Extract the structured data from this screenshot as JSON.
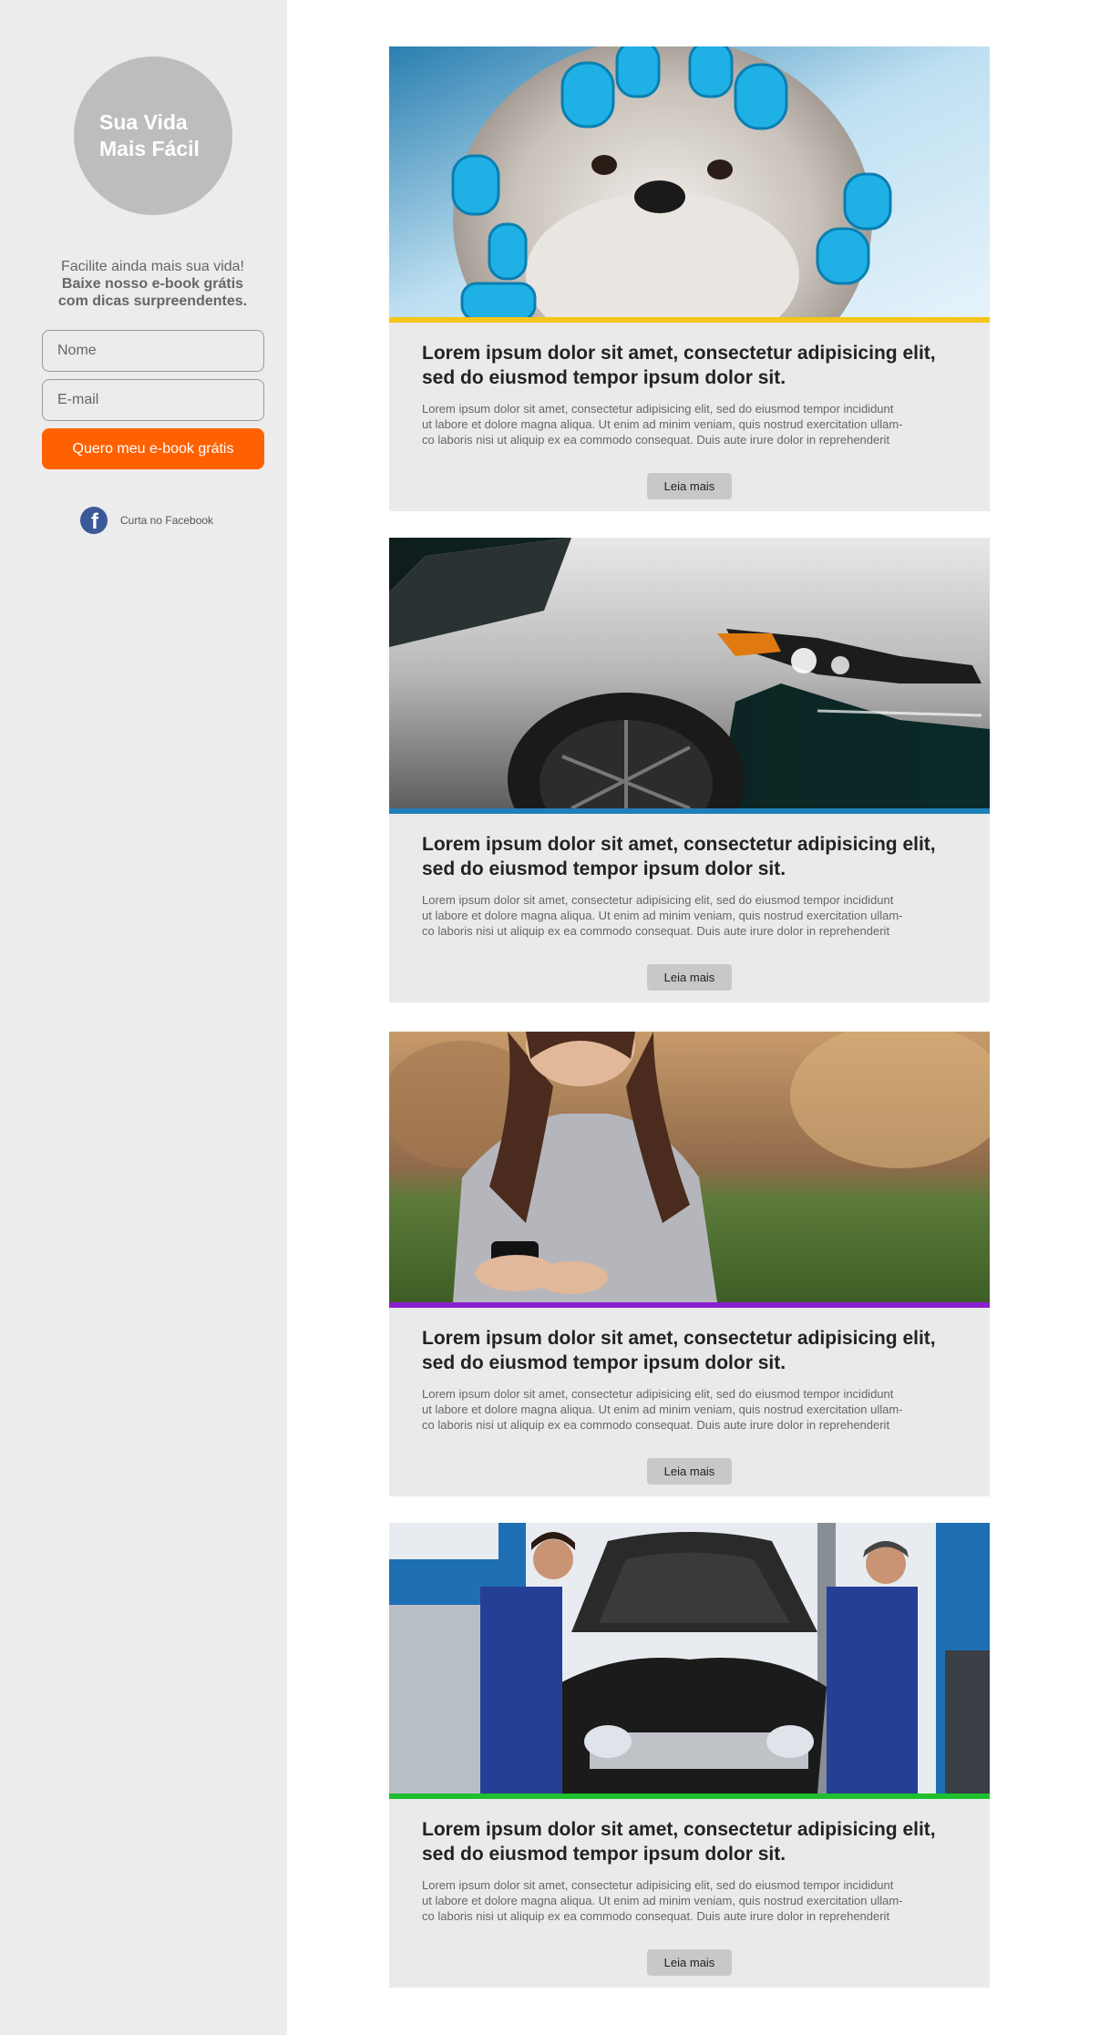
{
  "sidebar": {
    "logo_line1": "Sua Vida",
    "logo_line2": "Mais Fácil",
    "promo_line1": "Facilite ainda mais sua vida!",
    "promo_bold1": "Baixe nosso e-book grátis",
    "promo_bold2": "com dicas surpreendentes.",
    "name_placeholder": "Nome",
    "email_placeholder": "E-mail",
    "cta_label": "Quero meu e-book grátis",
    "facebook_icon_glyph": "f",
    "facebook_label": "Curta no Facebook"
  },
  "colors": {
    "cta": "#ff6100",
    "card1_accent": "#f5c518",
    "card2_accent": "#1f7fb8",
    "card3_accent": "#8a1fd0",
    "card4_accent": "#1fbf2f",
    "facebook": "#3b5998"
  },
  "cards": [
    {
      "image": "dog-with-hair-curlers",
      "title_line1": "Lorem ipsum dolor sit amet, consectetur adipisicing elit,",
      "title_line2": "sed do eiusmod tempor ipsum dolor sit.",
      "text_line1": "Lorem ipsum dolor sit amet, consectetur adipisicing elit, sed do eiusmod tempor incididunt",
      "text_line2": "ut labore et dolore magna aliqua. Ut enim ad minim veniam, quis nostrud exercitation ullam-",
      "text_line3": "co laboris nisi ut aliquip ex ea commodo consequat. Duis aute irure dolor in reprehenderit",
      "button": "Leia mais"
    },
    {
      "image": "silver-car-headlight",
      "title_line1": "Lorem ipsum dolor sit amet, consectetur adipisicing elit,",
      "title_line2": "sed do eiusmod tempor ipsum dolor sit.",
      "text_line1": "Lorem ipsum dolor sit amet, consectetur adipisicing elit, sed do eiusmod tempor incididunt",
      "text_line2": "ut labore et dolore magna aliqua. Ut enim ad minim veniam, quis nostrud exercitation ullam-",
      "text_line3": "co laboris nisi ut aliquip ex ea commodo consequat. Duis aute irure dolor in reprehenderit",
      "button": "Leia mais"
    },
    {
      "image": "woman-with-phone",
      "title_line1": "Lorem ipsum dolor sit amet, consectetur adipisicing elit,",
      "title_line2": "sed do eiusmod tempor ipsum dolor sit.",
      "text_line1": "Lorem ipsum dolor sit amet, consectetur adipisicing elit, sed do eiusmod tempor incididunt",
      "text_line2": "ut labore et dolore magna aliqua. Ut enim ad minim veniam, quis nostrud exercitation ullam-",
      "text_line3": "co laboris nisi ut aliquip ex ea commodo consequat. Duis aute irure dolor in reprehenderit",
      "button": "Leia mais"
    },
    {
      "image": "mechanics-with-car",
      "title_line1": "Lorem ipsum dolor sit amet, consectetur adipisicing elit,",
      "title_line2": "sed do eiusmod tempor ipsum dolor sit.",
      "text_line1": "Lorem ipsum dolor sit amet, consectetur adipisicing elit, sed do eiusmod tempor incididunt",
      "text_line2": "ut labore et dolore magna aliqua. Ut enim ad minim veniam, quis nostrud exercitation ullam-",
      "text_line3": "co laboris nisi ut aliquip ex ea commodo consequat. Duis aute irure dolor in reprehenderit",
      "button": "Leia mais"
    }
  ]
}
